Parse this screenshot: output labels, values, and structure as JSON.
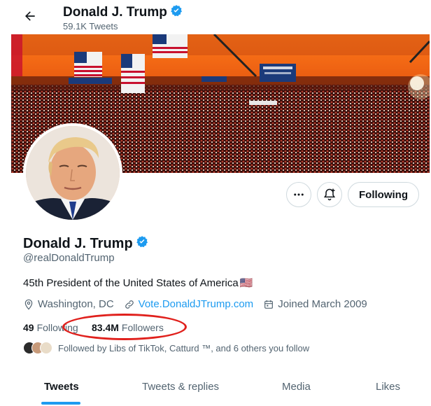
{
  "header": {
    "name": "Donald J. Trump",
    "tweet_count": "59.1K Tweets"
  },
  "actions": {
    "more_label": "More",
    "notify_label": "Notifications",
    "following_label": "Following"
  },
  "profile": {
    "name": "Donald J. Trump",
    "handle": "@realDonaldTrump",
    "bio": "45th President of the United States of America",
    "bio_emoji": "🇺🇸",
    "location": "Washington, DC",
    "website": "Vote.DonaldJTrump.com",
    "joined": "Joined March 2009",
    "following_count": "49",
    "following_label": "Following",
    "followers_count": "83.4M",
    "followers_label": "Followers",
    "followed_by": "Followed by Libs of TikTok, Catturd ™, and 6 others you follow"
  },
  "tabs": [
    {
      "label": "Tweets",
      "active": true
    },
    {
      "label": "Tweets & replies",
      "active": false
    },
    {
      "label": "Media",
      "active": false
    },
    {
      "label": "Likes",
      "active": false
    }
  ],
  "colors": {
    "accent": "#1d9bf0",
    "highlight_ellipse": "#e0201c",
    "verified": "#1d9bf0"
  },
  "icons": [
    "back-arrow-icon",
    "verified-badge-icon",
    "more-dots-icon",
    "bell-plus-icon",
    "location-pin-icon",
    "link-icon",
    "calendar-icon"
  ]
}
